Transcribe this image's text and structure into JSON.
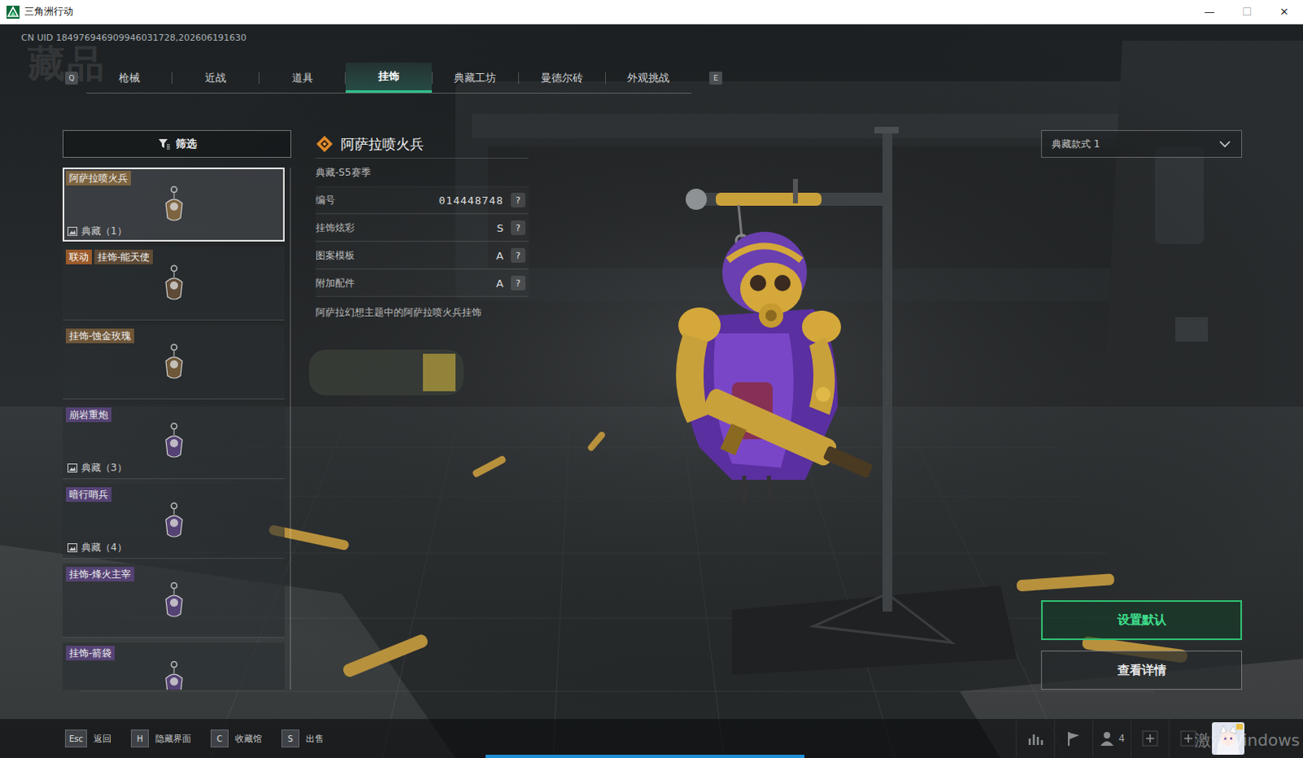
{
  "window": {
    "title": "三角洲行动",
    "controls": [
      "—",
      "☐",
      "✕"
    ]
  },
  "uid": "CN UID 184976946909946031728,202606191630",
  "page_title": "藏品",
  "tab_keys": {
    "prev": "Q",
    "next": "E"
  },
  "tabs": [
    {
      "label": "枪械",
      "selected": false
    },
    {
      "label": "近战",
      "selected": false
    },
    {
      "label": "道具",
      "selected": false
    },
    {
      "label": "挂饰",
      "selected": true
    },
    {
      "label": "典藏工坊",
      "selected": false
    },
    {
      "label": "曼德尔砖",
      "selected": false
    },
    {
      "label": "外观挑战",
      "selected": false
    }
  ],
  "filter": {
    "label": "筛选"
  },
  "items": [
    {
      "name": "阿萨拉喷火兵",
      "count": "典藏（1）",
      "selected": true,
      "color": "#7d6440"
    },
    {
      "badge": "联动",
      "name": "挂饰-能天使",
      "selected": false,
      "color": "#5e4a36"
    },
    {
      "name": "挂饰-蚀金玫瑰",
      "selected": false,
      "color": "#6e5638"
    },
    {
      "name": "崩岩重炮",
      "count": "典藏（3）",
      "selected": false,
      "color": "#554274"
    },
    {
      "name": "暗行哨兵",
      "count": "典藏（4）",
      "selected": false,
      "color": "#554274"
    },
    {
      "name": "挂饰-烽火主宰",
      "selected": false,
      "color": "#554274"
    },
    {
      "name": "挂饰-箭袋",
      "selected": false,
      "color": "#554274"
    }
  ],
  "detail": {
    "title": "阿萨拉喷火兵",
    "subtitle": "典藏-S5赛季",
    "rows": [
      {
        "label": "编号",
        "value": "014448748",
        "help": "?"
      },
      {
        "label": "挂饰炫彩",
        "value": "S",
        "help": "?"
      },
      {
        "label": "图案模板",
        "value": "A",
        "help": "?"
      },
      {
        "label": "附加配件",
        "value": "A",
        "help": "?"
      }
    ],
    "description": "阿萨拉幻想主题中的阿萨拉喷火兵挂饰"
  },
  "dropdown": {
    "label": "典藏款式 1",
    "expanded": false
  },
  "buttons": [
    {
      "label": "设置默认",
      "kind": "primary"
    },
    {
      "label": "查看详情",
      "kind": "secondary"
    }
  ],
  "hints": [
    {
      "key": "Esc",
      "label": "返回"
    },
    {
      "key": "H",
      "label": "隐藏界面"
    },
    {
      "key": "C",
      "label": "收藏馆"
    },
    {
      "key": "S",
      "label": "出售"
    }
  ],
  "party_count": "4",
  "bottom_indicator": {
    "level": 1
  },
  "watermark": "激活Windows"
}
